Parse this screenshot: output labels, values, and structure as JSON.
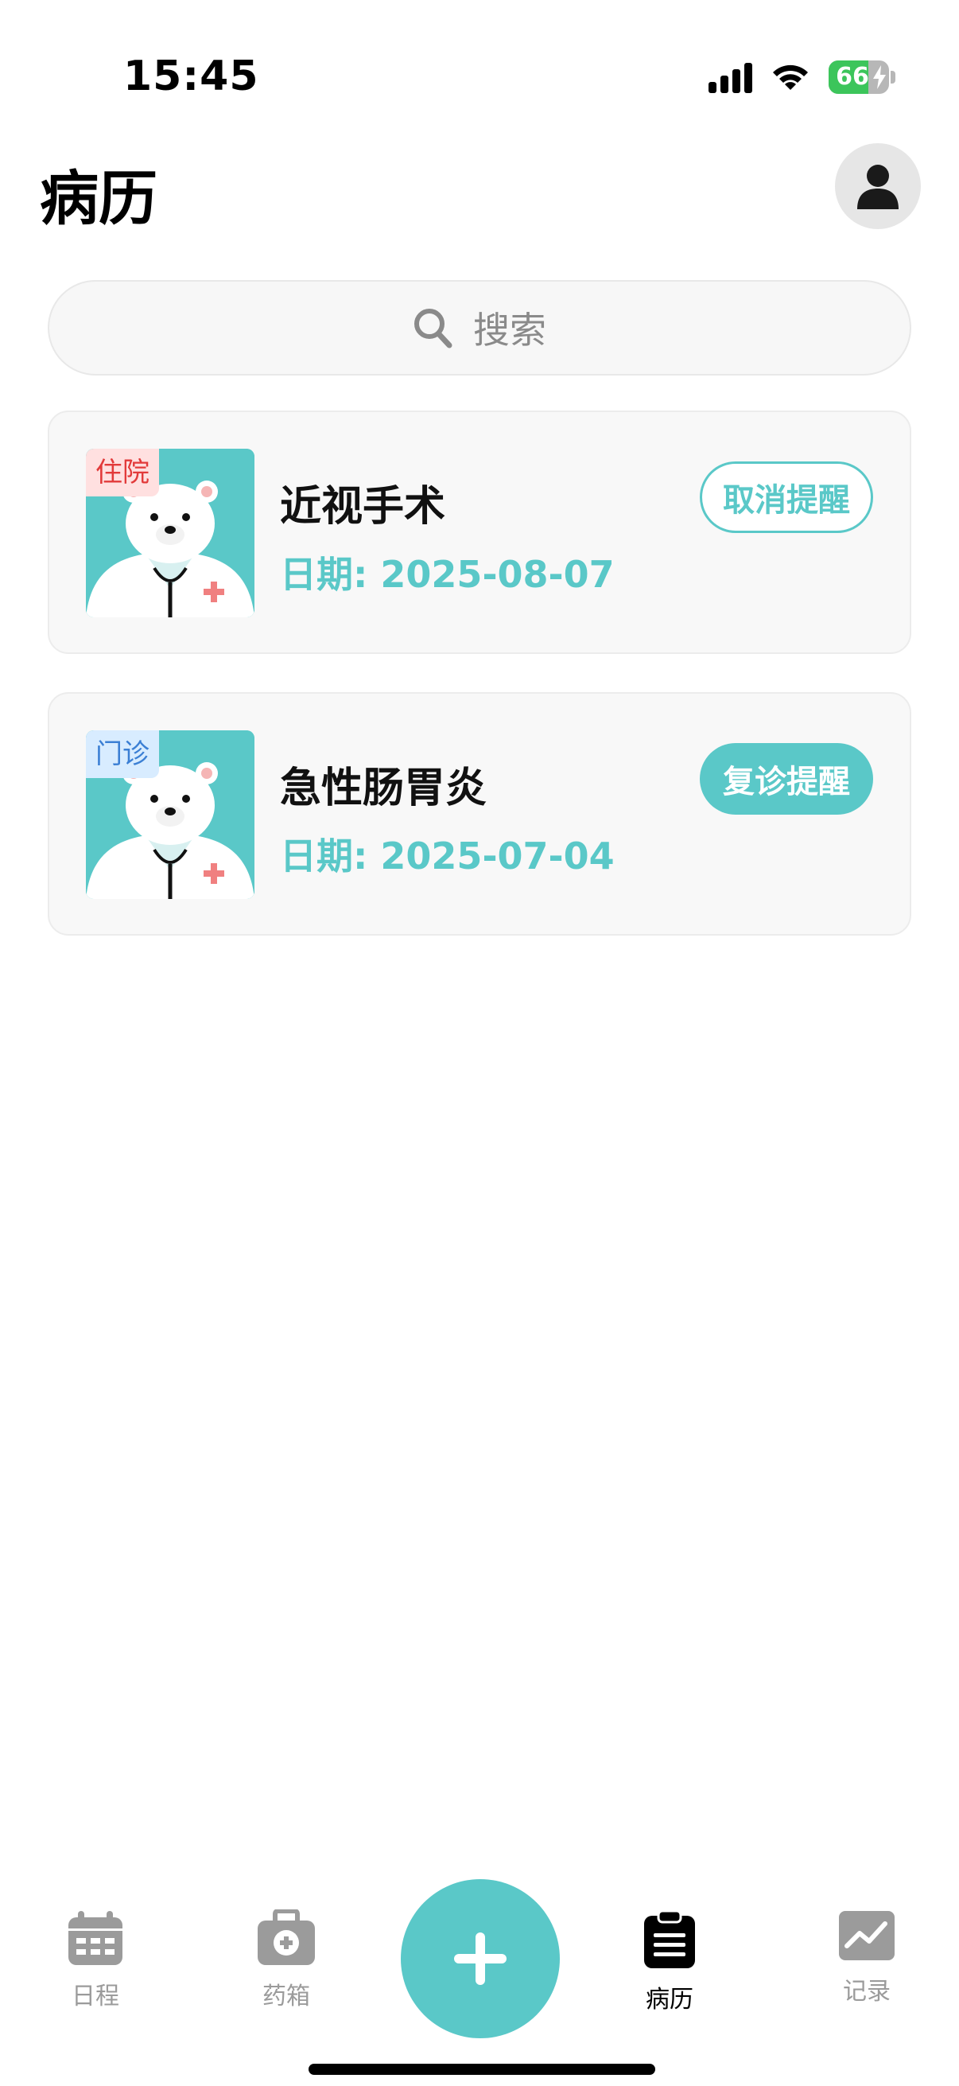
{
  "status_bar": {
    "time": "15:45",
    "battery": "66"
  },
  "header": {
    "title": "病历"
  },
  "search": {
    "placeholder": "搜索"
  },
  "records": [
    {
      "tag": "住院",
      "title": "近视手术",
      "date": "日期: 2025-08-07",
      "action": "取消提醒"
    },
    {
      "tag": "门诊",
      "title": "急性肠胃炎",
      "date": "日期: 2025-07-04",
      "action": "复诊提醒"
    }
  ],
  "tabs": [
    {
      "label": "日程",
      "icon": "calendar-icon"
    },
    {
      "label": "药箱",
      "icon": "medicine-box-icon"
    },
    {
      "label": "病历",
      "icon": "clipboard-icon"
    },
    {
      "label": "记录",
      "icon": "chart-icon"
    }
  ],
  "colors": {
    "accent": "#5ac8c8",
    "inpatient_tag": "#e23a3a",
    "outpatient_tag": "#3b7fd4",
    "inactive_tab": "#9b9b9b"
  }
}
